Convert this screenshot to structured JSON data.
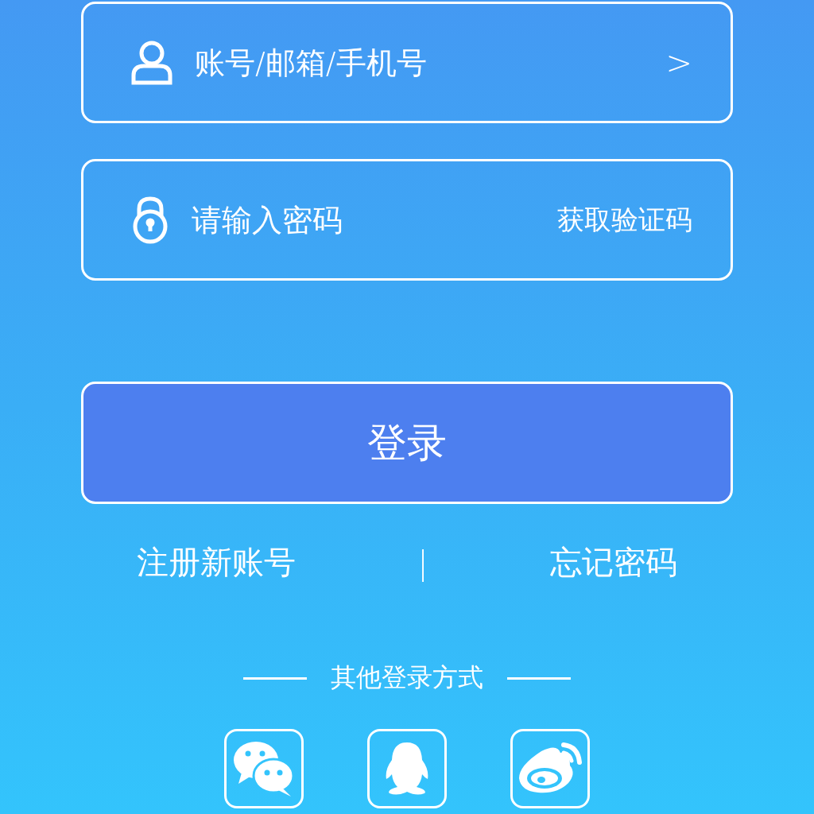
{
  "account_field": {
    "placeholder": "账号/邮箱/手机号",
    "arrow": ">"
  },
  "password_field": {
    "placeholder": "请输入密码",
    "code_link": "获取验证码"
  },
  "login_button": "登录",
  "links": [
    {
      "label": "注册新账号"
    },
    {
      "label": "忘记密码"
    }
  ],
  "links_separator": "|",
  "other_login": {
    "title": "其他登录方式",
    "providers": [
      {
        "kind": "chat"
      },
      {
        "kind": "penguin"
      },
      {
        "kind": "swirl"
      }
    ]
  }
}
